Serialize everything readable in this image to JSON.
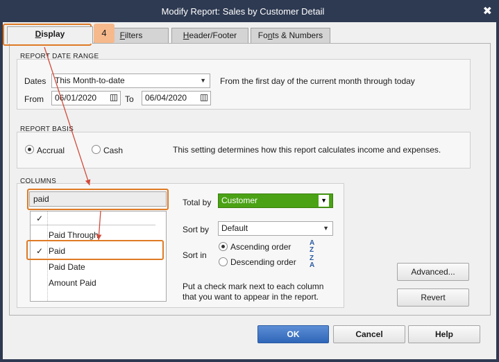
{
  "window": {
    "title": "Modify Report: Sales by Customer Detail",
    "close_glyph": "✖"
  },
  "tabs": [
    {
      "label": "Display",
      "key": "D",
      "rest": "isplay",
      "active": true
    },
    {
      "label": "Filters",
      "key": "F",
      "rest": "ilters"
    },
    {
      "label": "Header/Footer",
      "key": "H",
      "rest": "eader/Footer"
    },
    {
      "label": "Fonts & Numbers",
      "pre": "Fo",
      "key": "n",
      "rest": "ts & Numbers"
    }
  ],
  "step_badge": "4",
  "report_date_range": {
    "heading": "REPORT DATE RANGE",
    "dates_label": "Dates",
    "dates_value": "This Month-to-date",
    "description": "From the first day of the current month through today",
    "from_label": "From",
    "from_value": "06/01/2020",
    "to_label": "To",
    "to_value": "06/04/2020"
  },
  "report_basis": {
    "heading": "REPORT BASIS",
    "accrual_label": "Accrual",
    "cash_label": "Cash",
    "selected": "Accrual",
    "description": "This setting determines how this report calculates income and expenses."
  },
  "columns": {
    "heading": "COLUMNS",
    "search_value": "paid",
    "header_check": "✓",
    "items": [
      {
        "label": "Paid Through",
        "checked": false
      },
      {
        "label": "Paid",
        "checked": true
      },
      {
        "label": "Paid Date",
        "checked": false
      },
      {
        "label": "Amount Paid",
        "checked": false
      }
    ],
    "check_glyph": "✓",
    "total_by_label": "Total by",
    "total_by_value": "Customer",
    "sort_by_label": "Sort by",
    "sort_by_value": "Default",
    "sort_in_label": "Sort in",
    "ascending_label": "Ascending order",
    "descending_label": "Descending order",
    "sort_order_selected": "Ascending order",
    "hint": "Put a check mark next to each column that you want to appear in the report."
  },
  "buttons": {
    "advanced": "Advanced...",
    "revert": "Revert",
    "ok": "OK",
    "cancel": "Cancel",
    "help": "Help"
  },
  "colors": {
    "titlebar": "#2e3a52",
    "highlight": "#de7a24",
    "badge": "#f6b98c",
    "total_by_field": "#4aa214",
    "ok_button": "#2f66b8",
    "annotation_arrow": "#d24a3a"
  }
}
